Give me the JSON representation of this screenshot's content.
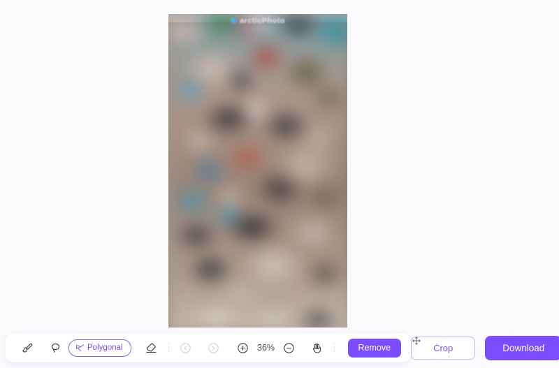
{
  "canvas": {
    "watermark_text": "arcticPhoto",
    "image_alt": "blurred crowd photograph",
    "selection_active": true
  },
  "toolbar": {
    "tools": [
      {
        "id": "brush",
        "icon": "brush-icon",
        "label": "Brush",
        "active": false,
        "disabled": false
      },
      {
        "id": "lasso",
        "icon": "lasso-icon",
        "label": "Lasso",
        "active": false,
        "disabled": false
      },
      {
        "id": "polygonal",
        "icon": "polygonal-icon",
        "label": "Polygonal",
        "active": true,
        "disabled": false
      },
      {
        "id": "eraser",
        "icon": "eraser-icon",
        "label": "Eraser",
        "active": false,
        "disabled": false
      },
      {
        "id": "undo",
        "icon": "undo-icon",
        "label": "Undo",
        "active": false,
        "disabled": true
      },
      {
        "id": "redo",
        "icon": "redo-icon",
        "label": "Redo",
        "active": false,
        "disabled": true
      },
      {
        "id": "zoom-in",
        "icon": "zoom-in-icon",
        "label": "Zoom in",
        "active": false,
        "disabled": false
      },
      {
        "id": "zoom-out",
        "icon": "zoom-out-icon",
        "label": "Zoom out",
        "active": false,
        "disabled": false
      },
      {
        "id": "pan",
        "icon": "hand-icon",
        "label": "Pan",
        "active": false,
        "disabled": false
      }
    ],
    "polygonal_label": "Polygonal",
    "zoom_level": "36%",
    "remove_label": "Remove",
    "drag_handle_icon": "move-icon"
  },
  "actions": {
    "crop_label": "Crop",
    "download_label": "Download"
  },
  "colors": {
    "accent": "#7c4dff",
    "accent_soft": "#c9b6fb",
    "page_bg": "#fbfbfe",
    "card_bg": "#ffffff",
    "icon": "#3f3f46",
    "icon_disabled": "#cfd0d8"
  }
}
